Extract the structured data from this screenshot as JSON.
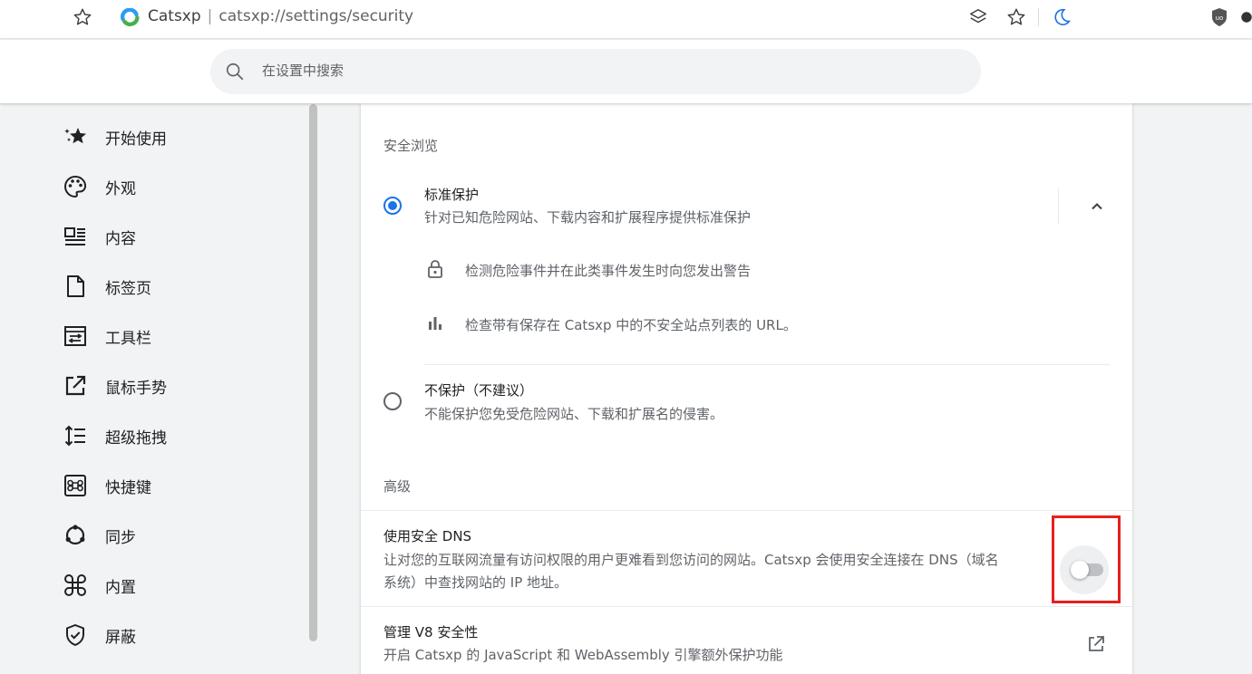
{
  "browser": {
    "site_name": "Catsxp",
    "url": "catsxp://settings/security",
    "separator": "|"
  },
  "search": {
    "placeholder": "在设置中搜索"
  },
  "sidebar": {
    "items": [
      {
        "label": "开始使用",
        "icon": "sparkle-star-icon"
      },
      {
        "label": "外观",
        "icon": "palette-icon"
      },
      {
        "label": "内容",
        "icon": "article-icon"
      },
      {
        "label": "标签页",
        "icon": "page-icon"
      },
      {
        "label": "工具栏",
        "icon": "toolbar-icon"
      },
      {
        "label": "鼠标手势",
        "icon": "open-external-icon"
      },
      {
        "label": "超级拖拽",
        "icon": "sort-list-icon"
      },
      {
        "label": "快捷键",
        "icon": "command-key-icon"
      },
      {
        "label": "同步",
        "icon": "sync-icon"
      },
      {
        "label": "内置",
        "icon": "apps-icon"
      },
      {
        "label": "屏蔽",
        "icon": "shield-check-icon"
      }
    ]
  },
  "safe_browsing": {
    "section_title": "安全浏览",
    "standard": {
      "title": "标准保护",
      "description": "针对已知危险网站、下载内容和扩展程序提供标准保护",
      "selected": true,
      "details": [
        {
          "text": "检测危险事件并在此类事件发生时向您发出警告",
          "icon": "lock-icon"
        },
        {
          "text": "检查带有保存在 Catsxp 中的不安全站点列表的 URL。",
          "icon": "bar-chart-icon"
        }
      ]
    },
    "none": {
      "title": "不保护（不建议）",
      "description": "不能保护您免受危险网站、下载和扩展名的侵害。",
      "selected": false
    }
  },
  "advanced": {
    "section_title": "高级",
    "secure_dns": {
      "title": "使用安全 DNS",
      "description_line1": "让对您的互联网流量有访问权限的用户更难看到您访问的网站。Catsxp 会使用安全连接在 DNS（域名",
      "description_line2": "系统）中查找网站的 IP 地址。",
      "enabled": false
    },
    "v8": {
      "title": "管理 V8 安全性",
      "description": "开启 Catsxp 的 JavaScript 和 WebAssembly 引擎额外保护功能"
    }
  },
  "colors": {
    "accent": "#1a73e8",
    "highlight_box": "#e8201c"
  }
}
